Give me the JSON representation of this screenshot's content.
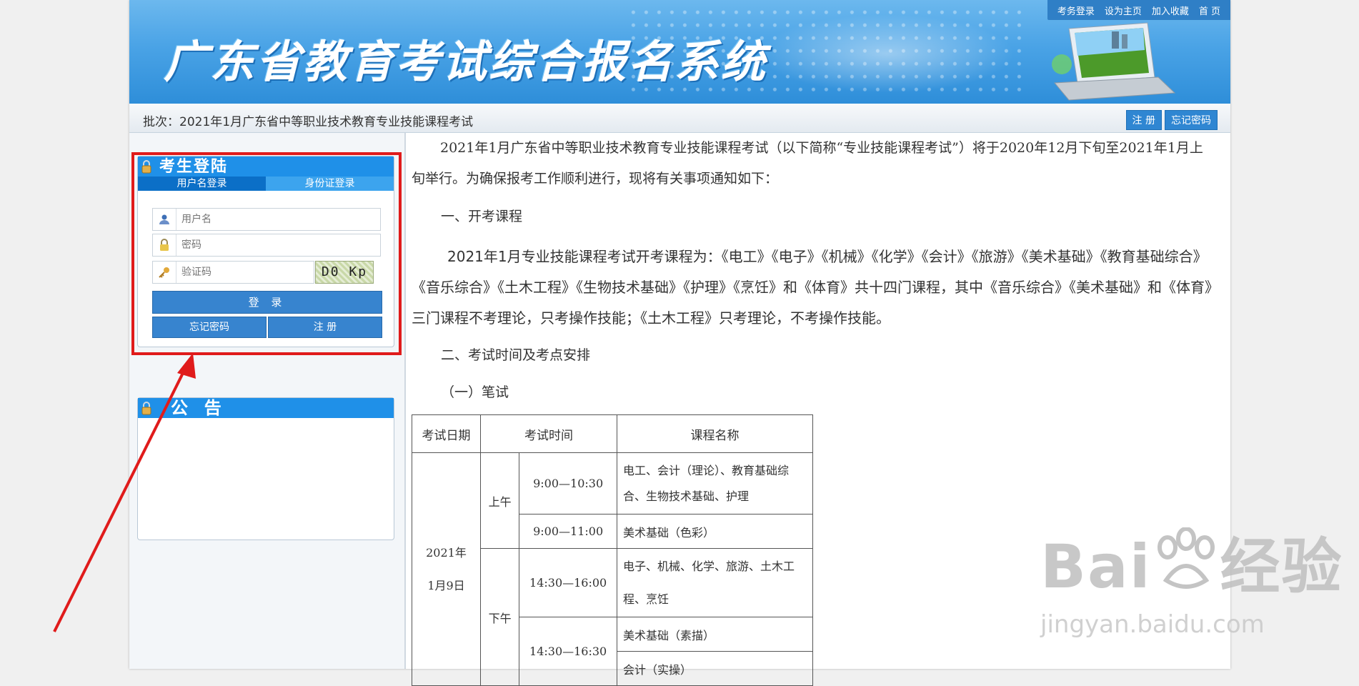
{
  "header": {
    "site_title": "广东省教育考试综合报名系统",
    "top_links": [
      "考务登录",
      "设为主页",
      "加入收藏",
      "首 页"
    ]
  },
  "batch": {
    "text": "批次：2021年1月广东省中等职业技术教育专业技能课程考试",
    "register_label": "注 册",
    "forgot_label": "忘记密码"
  },
  "login": {
    "heading": "考生登陆",
    "tabs": [
      "用户名登录",
      "身份证登录"
    ],
    "username_placeholder": "用户名",
    "password_placeholder": "密码",
    "captcha_placeholder": "验证码",
    "captcha_text": "D0 Kp",
    "login_label": "登 录",
    "forgot_label": "忘记密码",
    "register_label": "注 册"
  },
  "notice": {
    "heading": "公  告"
  },
  "content": {
    "intro": "2021年1月广东省中等职业技术教育专业技能课程考试（以下简称“专业技能课程考试”）将于2020年12月下旬至2021年1月上旬举行。为确保报考工作顺利进行，现将有关事项通知如下：",
    "section1": "一、开考课程",
    "courses": "2021年1月专业技能课程考试开考课程为：《电工》《电子》《机械》《化学》《会计》《旅游》《美术基础》《教育基础综合》《音乐综合》《土木工程》《生物技术基础》《护理》《烹饪》和《体育》共十四门课程，其中《音乐综合》《美术基础》和《体育》三门课程不考理论，只考操作技能；《土木工程》只考理论，不考操作技能。",
    "section2": "二、考试时间及考点安排",
    "sub1": "（一）笔试",
    "table": {
      "headers": [
        "考试日期",
        "考试时间",
        "课程名称"
      ],
      "date": "2021年\n1月9日",
      "am": "上午",
      "pm": "下午",
      "rows": [
        {
          "time": "9:00—10:30",
          "course": "电工、会计（理论）、教育基础综合、生物技术基础、护理"
        },
        {
          "time": "9:00—11:00",
          "course": "美术基础（色彩）"
        },
        {
          "time": "14:30—16:00",
          "course": "电子、机械、化学、旅游、土木工程、烹饪"
        },
        {
          "time": "14:30—16:30",
          "course": "美术基础（素描）"
        },
        {
          "time": "",
          "course": "会计（实操）"
        }
      ]
    }
  },
  "watermark": {
    "brand": "Bai",
    "brand2": "经验",
    "url": "jingyan.baidu.com"
  },
  "colors": {
    "accent": "#2f86d2",
    "highlight": "#e01b1b"
  }
}
